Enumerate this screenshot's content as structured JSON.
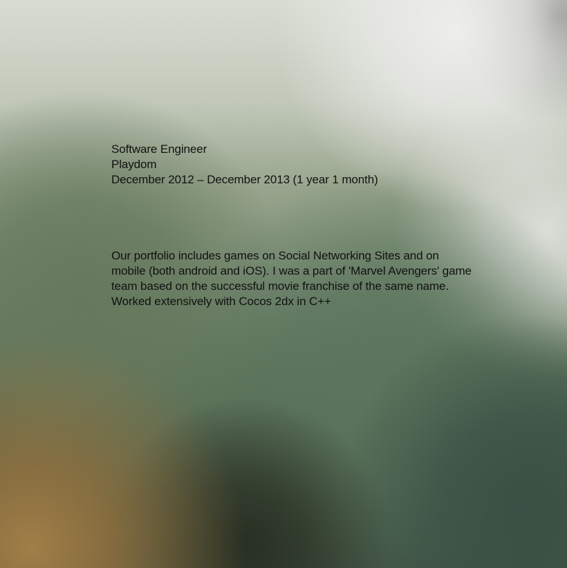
{
  "job": {
    "title": "Software Engineer",
    "company": "Playdom",
    "dates": "December 2012 – December 2013 (1 year 1 month)",
    "description": "Our portfolio includes games on Social Networking Sites and on mobile (both android and iOS). I was a part of 'Marvel Avengers' game team based on the successful movie franchise of the same name. Worked extensively with Cocos 2dx in C++"
  }
}
